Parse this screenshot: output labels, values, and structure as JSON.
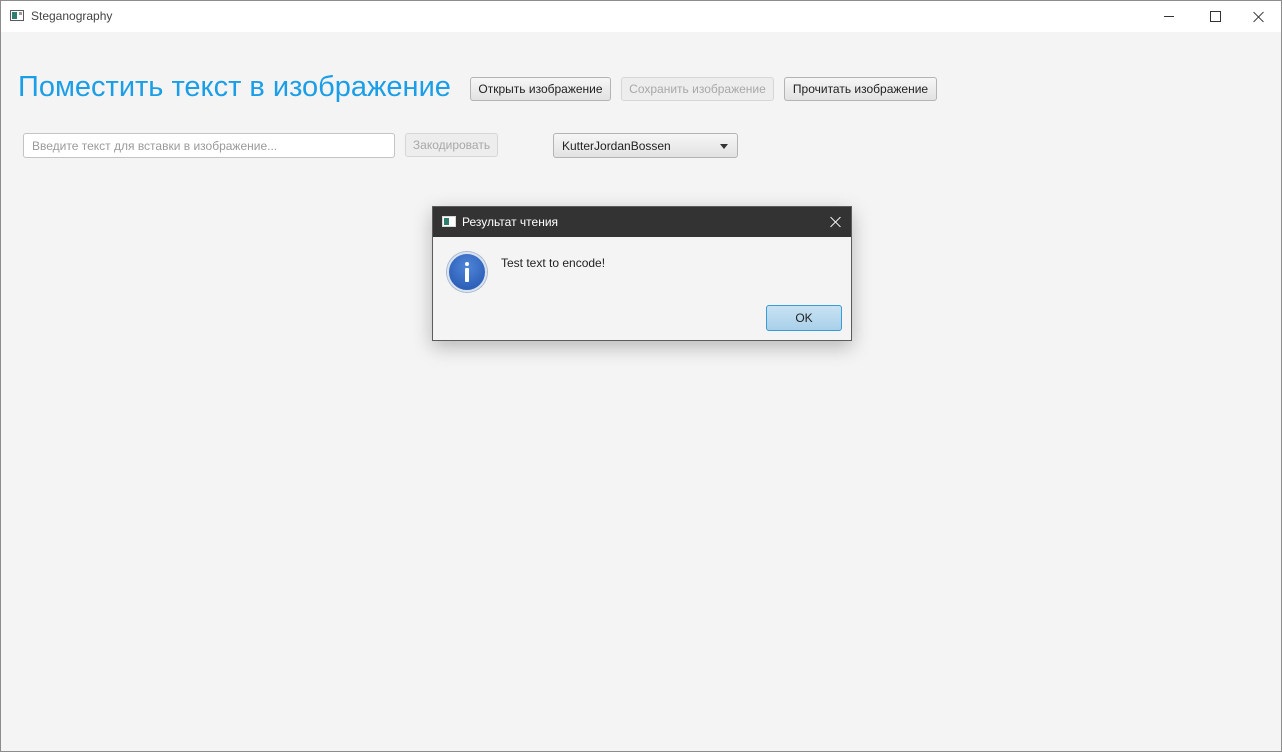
{
  "window": {
    "title": "Steganography"
  },
  "header": {
    "heading": "Поместить текст в изображение",
    "open_label": "Открыть изображение",
    "save_label": "Сохранить изображение",
    "read_label": "Прочитать изображение"
  },
  "encode": {
    "placeholder": "Введите текст для вставки в изображение...",
    "value": "",
    "encode_label": "Закодировать",
    "algorithm_selected": "KutterJordanBossen"
  },
  "dialog": {
    "title": "Результат чтения",
    "message": "Test text to encode!",
    "ok_label": "OK",
    "icon": "info-icon"
  },
  "colors": {
    "heading": "#1a9ee8",
    "dialog_titlebar": "#333333",
    "ok_button": "#a9d0ea"
  }
}
